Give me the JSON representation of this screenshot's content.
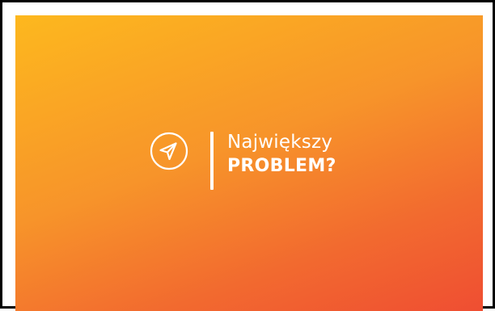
{
  "slide": {
    "heading_line1": "Największy",
    "heading_line2": "PROBLEM?",
    "icon": "navigation-arrow-icon",
    "colors": {
      "gradient_start": "#fdb81e",
      "gradient_mid": "#f7942a",
      "gradient_end": "#ef4e32",
      "text": "#ffffff"
    }
  }
}
